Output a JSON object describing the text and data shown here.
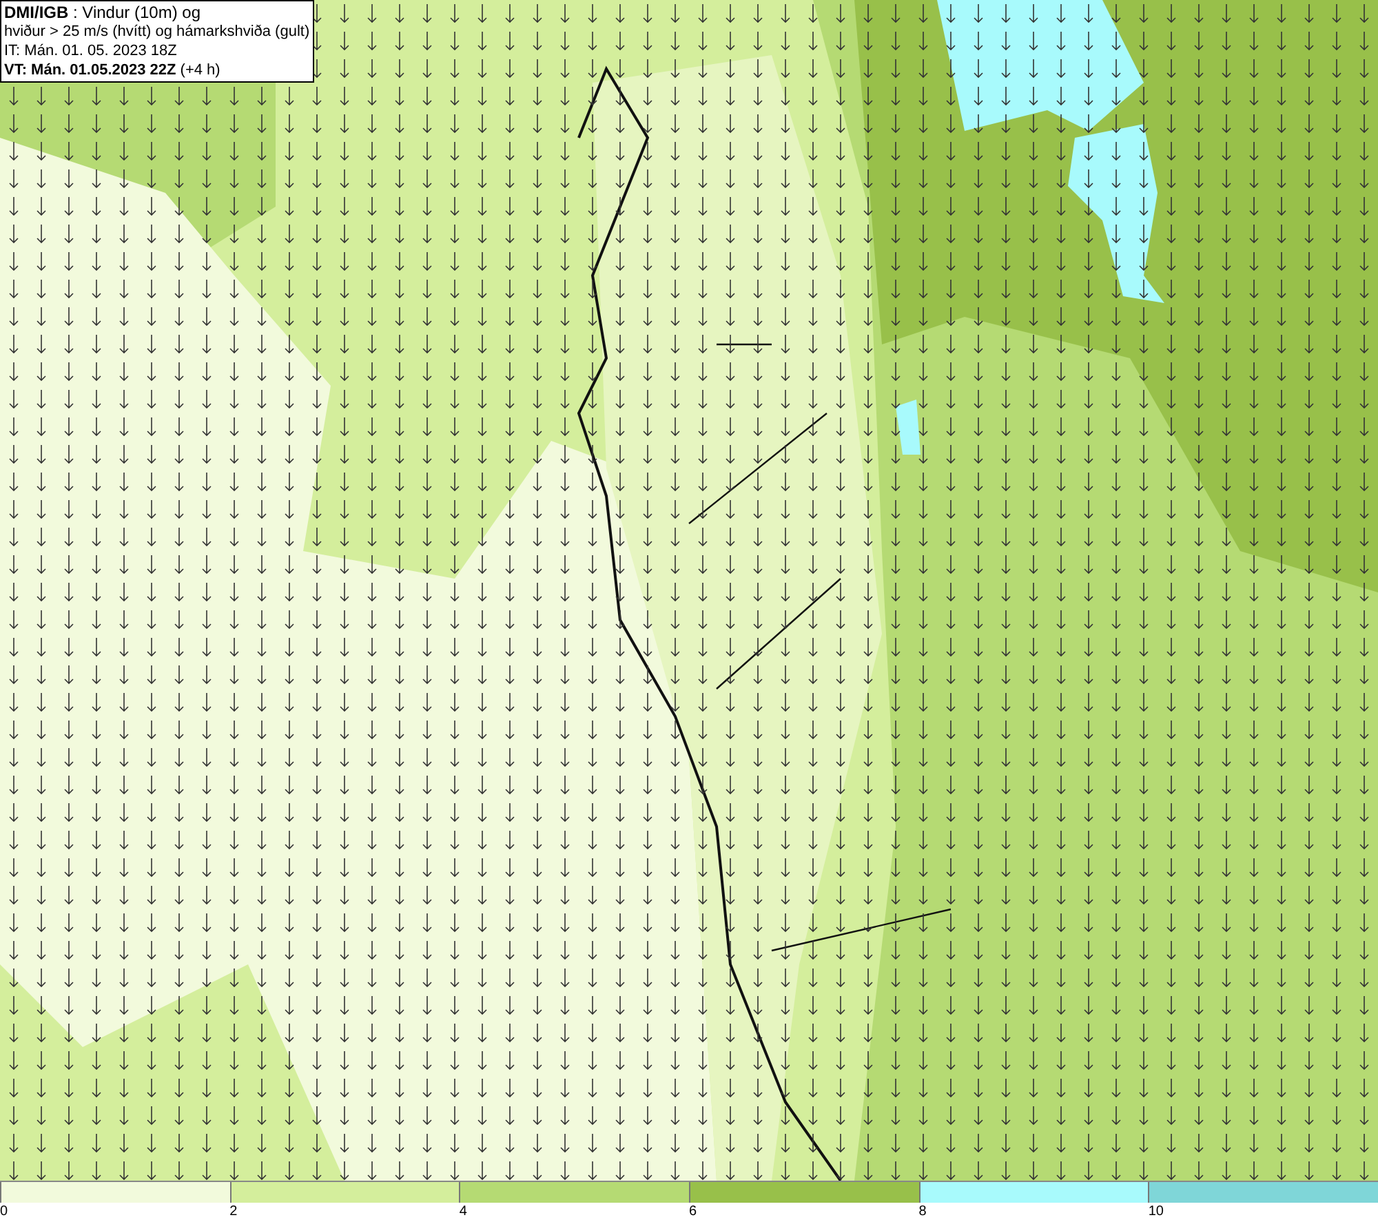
{
  "header": {
    "lines": [
      "**DMI/IGB** : Vindur (10m) og",
      "hviður > 25 m/s (hvítt) og hámarkshviða (gult)",
      "IT: Mán. 01. 05. 2023 18Z",
      "**VT: Mán. 01.05.2023 22Z** (+4 h)"
    ]
  },
  "legend": {
    "segments": [
      {
        "color": "#f2fadc",
        "label": "0"
      },
      {
        "color": "#d4ee9c",
        "label": "2"
      },
      {
        "color": "#b5da73",
        "label": "4"
      },
      {
        "color": "#98c04a",
        "label": "6"
      },
      {
        "color": "#a8fafc",
        "label": "8"
      },
      {
        "color": "#7fd6d8",
        "label": "10"
      }
    ]
  }
}
